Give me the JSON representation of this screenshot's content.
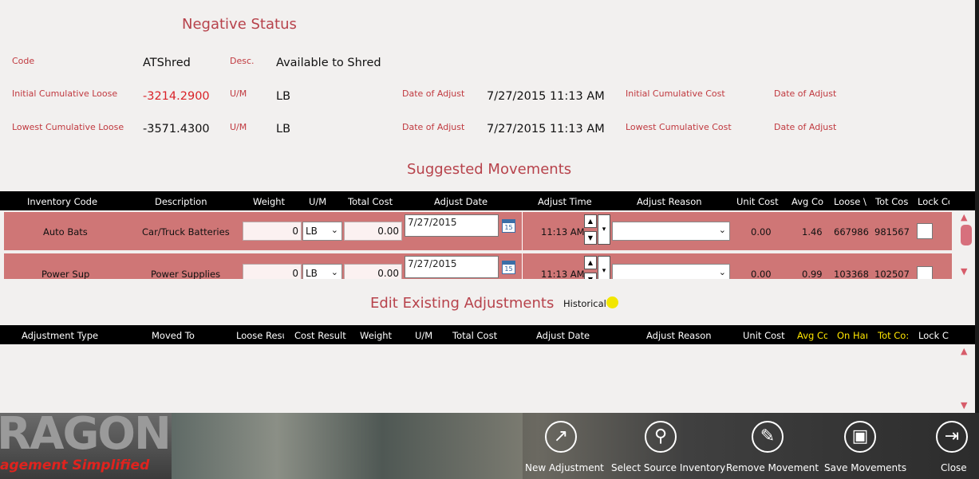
{
  "negative_status": {
    "title": "Negative Status",
    "code_label": "Code",
    "code_value": "ATShred",
    "desc_label": "Desc.",
    "desc_value": "Available to Shred",
    "initial_loose_label": "Initial Cumulative Loose",
    "initial_loose_value": "-3214.2900",
    "um_label_1": "U/M",
    "um_value_1": "LB",
    "date_adjust_label_1": "Date of Adjust",
    "date_adjust_value_1": "7/27/2015 11:13 AM",
    "initial_cost_label": "Initial Cumulative Cost",
    "date_adjust_label_2": "Date of Adjust",
    "lowest_loose_label": "Lowest Cumulative Loose",
    "lowest_loose_value": "-3571.4300",
    "um_label_2": "U/M",
    "um_value_2": "LB",
    "date_adjust_label_3": "Date of Adjust",
    "date_adjust_value_3": "7/27/2015 11:13 AM",
    "lowest_cost_label": "Lowest Cumulative Cost",
    "date_adjust_label_4": "Date of Adjust"
  },
  "suggested": {
    "title": "Suggested Movements",
    "columns": [
      "Inventory Code",
      "Description",
      "Weight",
      "U/M",
      "Total Cost",
      "Adjust Date",
      "Adjust Time",
      "Adjust Reason",
      "Unit Cost",
      "Avg Co",
      "Loose \\",
      "Tot Cos",
      "Lock Cc"
    ],
    "rows": [
      {
        "code": "Auto Bats",
        "description": "Car/Truck Batteries",
        "weight": "0",
        "um": "LB",
        "total_cost": "0.00",
        "date": "7/27/2015",
        "date_icon": "15",
        "time": "11:13 AM",
        "reason": "",
        "unit_cost": "0.00",
        "avg_cost": "1.46",
        "loose": "667986.",
        "tot_cost": "981567."
      },
      {
        "code": "Power Sup",
        "description": "Power Supplies",
        "weight": "0",
        "um": "LB",
        "total_cost": "0.00",
        "date": "7/27/2015",
        "date_icon": "15",
        "time": "11:13 AM",
        "reason": "",
        "unit_cost": "0.00",
        "avg_cost": "0.99",
        "loose": "103368.",
        "tot_cost": "102507."
      }
    ]
  },
  "existing": {
    "title": "Edit Existing Adjustments",
    "historical_label": "Historical",
    "historical_color": "#f2e600",
    "columns": [
      "Adjustment Type",
      "Moved To",
      "Loose Resu",
      "Cost Result",
      "Weight",
      "U/M",
      "Total Cost",
      "Adjust Date",
      "Adjust Reason",
      "Unit Cost",
      "Avg Co",
      "On Har",
      "Tot Co:",
      "Lock Cc"
    ]
  },
  "brand": {
    "line1": "RAGON",
    "line2": "agement Simplified"
  },
  "toolbar": {
    "new_adjustment": "New Adjustment",
    "select_source": "Select Source Inventory",
    "remove_movement": "Remove Movement",
    "save_movements": "Save Movements",
    "close": "Close"
  }
}
